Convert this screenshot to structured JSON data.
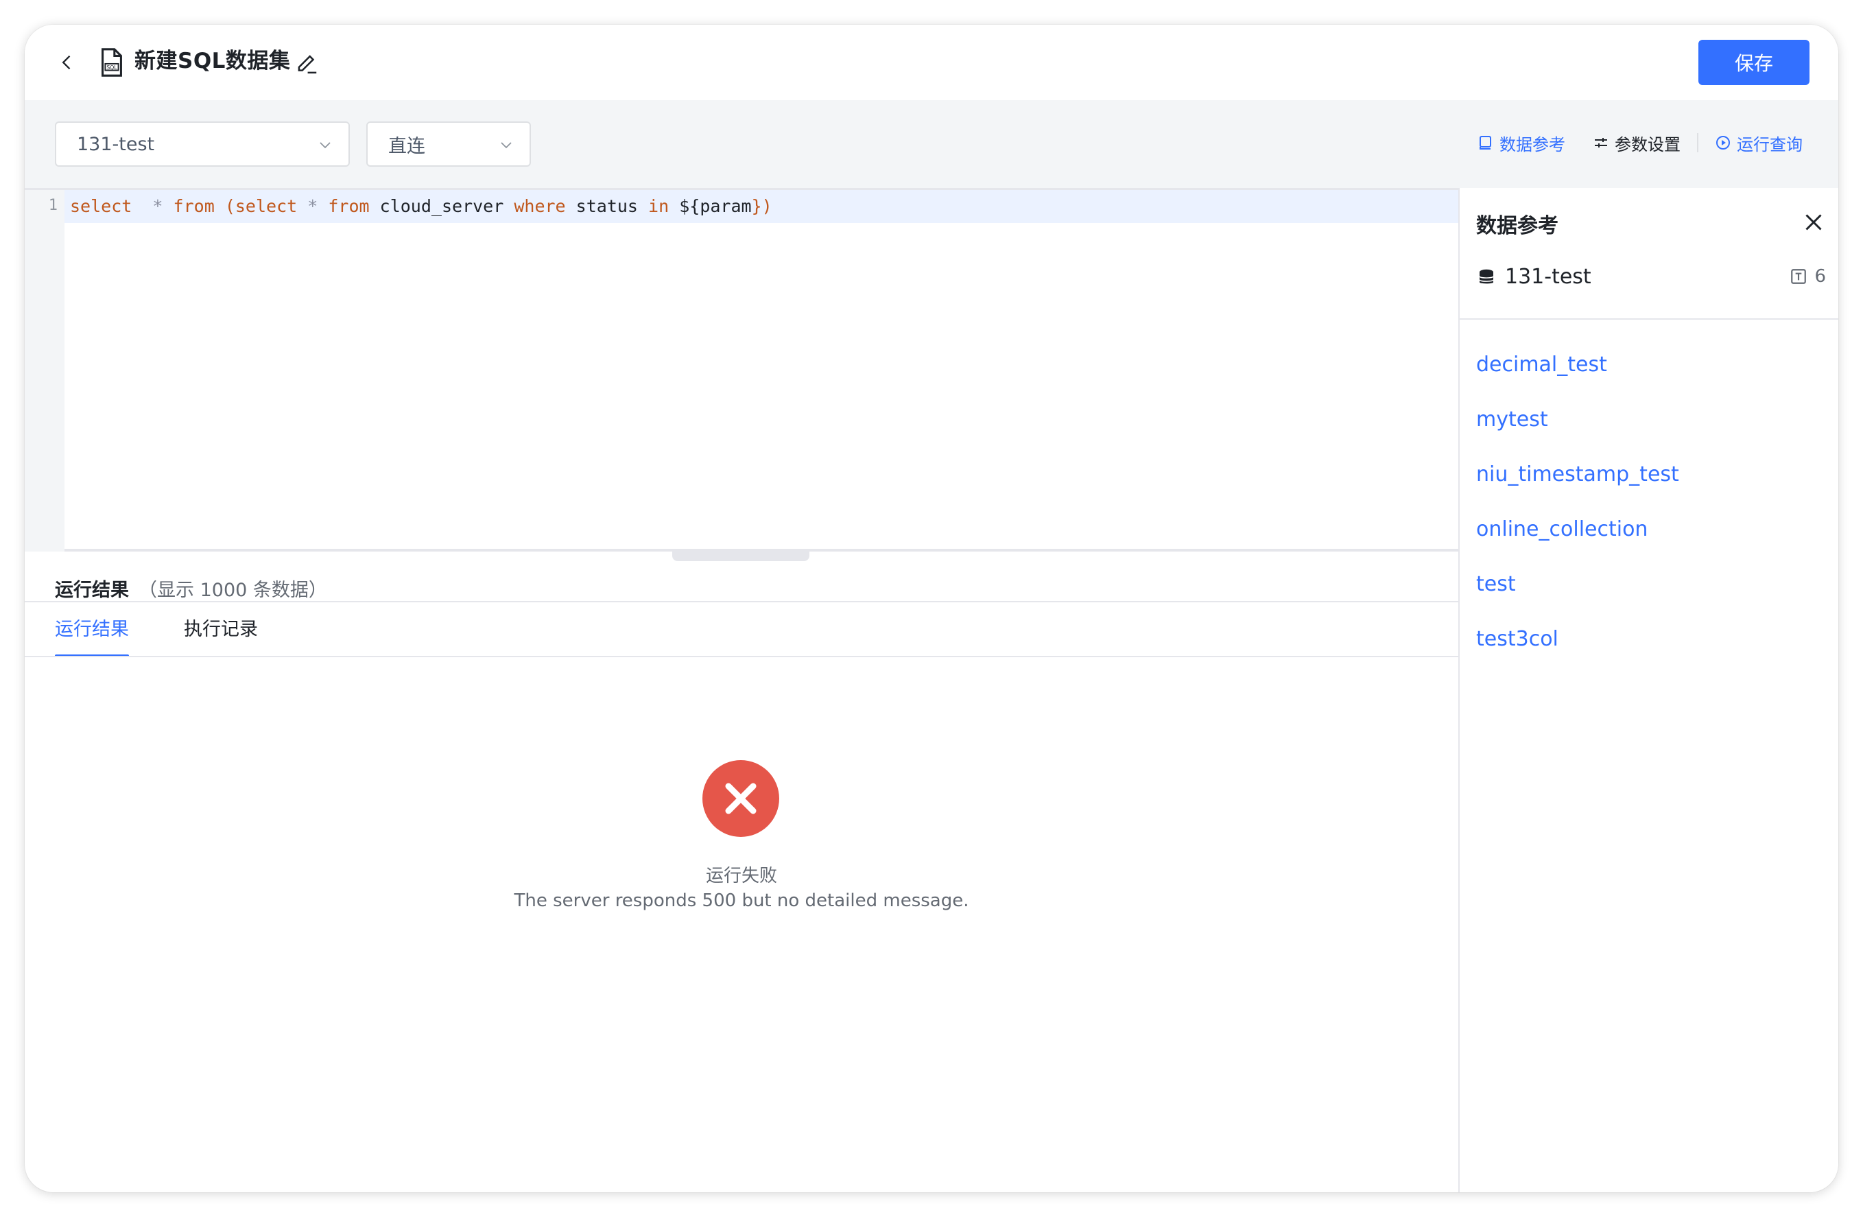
{
  "header": {
    "title": "新建SQL数据集",
    "save_label": "保存"
  },
  "toolbar": {
    "datasource": "131-test",
    "mode": "直连",
    "actions": {
      "data_reference": "数据参考",
      "param_settings": "参数设置",
      "run_query": "运行查询"
    }
  },
  "editor": {
    "line_number": "1",
    "tokens": {
      "t1": "select",
      "t2": "*",
      "t3": "from",
      "t4": "(select",
      "t5": "*",
      "t6": "from",
      "t7": "cloud_server",
      "t8": "where",
      "t9": "status",
      "t10": "in",
      "t11": "${param",
      "t12": "})"
    }
  },
  "results": {
    "title": "运行结果",
    "note": "（显示 1000 条数据）",
    "tabs": [
      "运行结果",
      "执行记录"
    ],
    "error_title": "运行失败",
    "error_message": "The server responds 500 but no detailed message."
  },
  "panel": {
    "title": "数据参考",
    "datasource": "131-test",
    "table_count": "6",
    "tables": [
      "decimal_test",
      "mytest",
      "niu_timestamp_test",
      "online_collection",
      "test",
      "test3col"
    ]
  },
  "colors": {
    "accent": "#3370ff",
    "error": "#e5564a",
    "keyword": "#c0581d"
  },
  "icons": {
    "back": "chevron-left-icon",
    "doc": "sql-file-icon",
    "edit": "pencil-icon",
    "close": "close-icon",
    "database": "database-icon",
    "table": "table-icon",
    "error": "error-circle-icon"
  }
}
